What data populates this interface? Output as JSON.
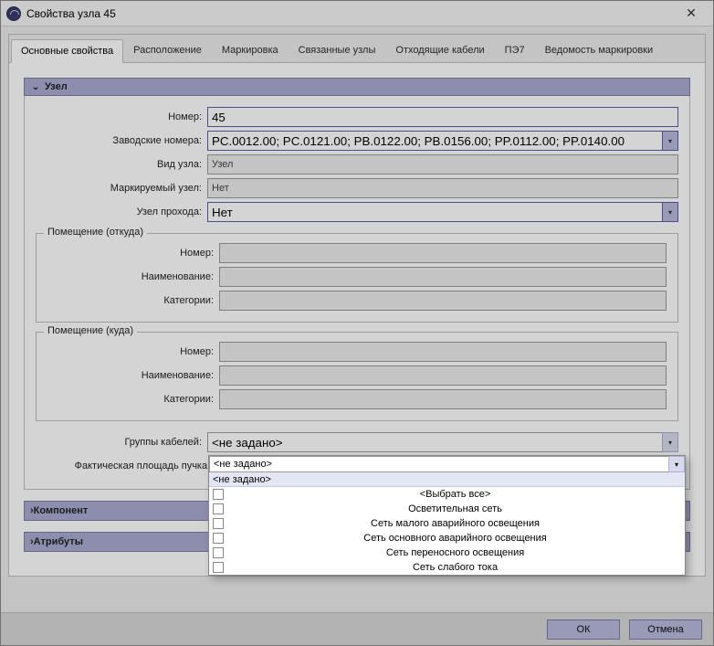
{
  "window": {
    "title": "Свойства узла 45"
  },
  "tabs": {
    "items": [
      {
        "label": "Основные свойства"
      },
      {
        "label": "Расположение"
      },
      {
        "label": "Маркировка"
      },
      {
        "label": "Связанные узлы"
      },
      {
        "label": "Отходящие кабели"
      },
      {
        "label": "ПЭ7"
      },
      {
        "label": "Ведомость маркировки"
      }
    ],
    "active_index": 0
  },
  "section_node": {
    "title": "Узел",
    "fields": {
      "number_label": "Номер:",
      "number_value": "45",
      "factory_label": "Заводские номера:",
      "factory_value": "PC.0012.00; PC.0121.00; PB.0122.00; PB.0156.00; PP.0112.00; PP.0140.00",
      "kind_label": "Вид узла:",
      "kind_value": "Узел",
      "marked_label": "Маркируемый узел:",
      "marked_value": "Нет",
      "passage_label": "Узел прохода:",
      "passage_value": "Нет"
    },
    "room_from": {
      "legend": "Помещение (откуда)",
      "number_label": "Номер:",
      "number_value": "",
      "name_label": "Наименование:",
      "name_value": "",
      "cat_label": "Категории:",
      "cat_value": ""
    },
    "room_to": {
      "legend": "Помещение (куда)",
      "number_label": "Номер:",
      "number_value": "",
      "name_label": "Наименование:",
      "name_value": "",
      "cat_label": "Категории:",
      "cat_value": ""
    },
    "groups_label": "Группы кабелей:",
    "groups_value": "<не задано>",
    "area_label": "Фактическая площадь пучка, см²:"
  },
  "collapsed_sections": [
    {
      "title": "Компонент"
    },
    {
      "title": "Атрибуты"
    }
  ],
  "buttons": {
    "ok": "ОК",
    "cancel": "Отмена"
  },
  "dropdown": {
    "selected_text": "<не задано>",
    "options": [
      {
        "label": "<Выбрать все>"
      },
      {
        "label": "Осветительная сеть"
      },
      {
        "label": "Сеть малого аварийного освещения"
      },
      {
        "label": "Сеть основного аварийного освещения"
      },
      {
        "label": "Сеть переносного освещения"
      },
      {
        "label": "Сеть слабого тока"
      }
    ]
  }
}
